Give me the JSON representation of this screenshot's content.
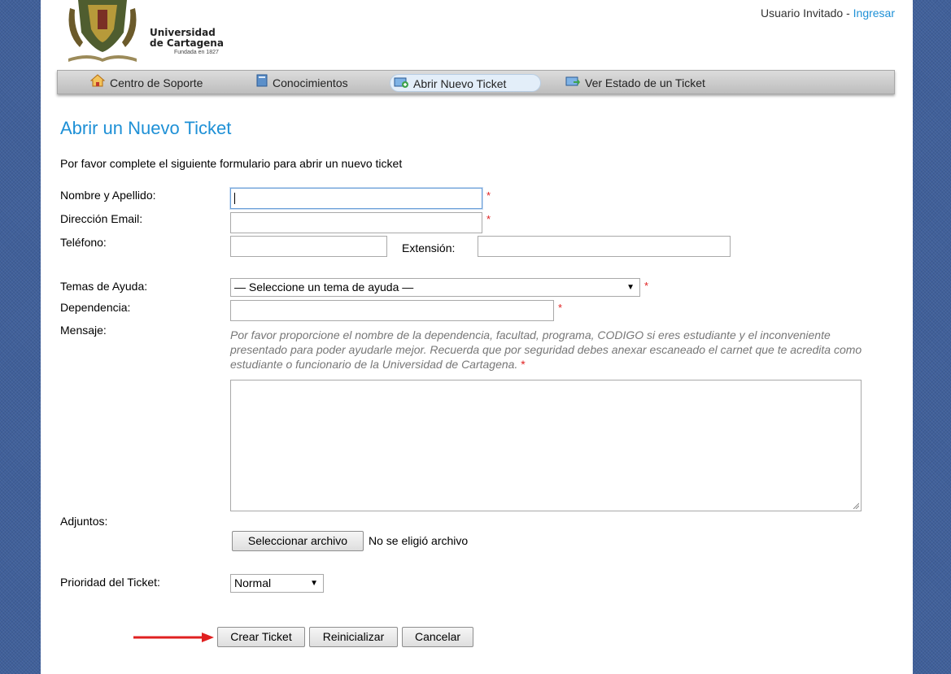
{
  "header": {
    "logo_line1": "Universidad",
    "logo_line2": "de Cartagena",
    "logo_line3": "Fundada en 1827",
    "user_status": "Usuario Invitado",
    "separator": " - ",
    "login_link": "Ingresar"
  },
  "nav": {
    "items": [
      {
        "label": "Centro de Soporte",
        "icon": "home-icon"
      },
      {
        "label": "Conocimientos",
        "icon": "book-icon"
      },
      {
        "label": "Abrir Nuevo Ticket",
        "icon": "new-ticket-icon",
        "active": true
      },
      {
        "label": "Ver Estado de un Ticket",
        "icon": "ticket-status-icon"
      }
    ]
  },
  "page": {
    "title": "Abrir un Nuevo Ticket",
    "intro": "Por favor complete el siguiente formulario para abrir un nuevo ticket"
  },
  "form": {
    "name_label": "Nombre y Apellido:",
    "email_label": "Dirección Email:",
    "phone_label": "Teléfono:",
    "extension_label": "Extensión:",
    "topic_label": "Temas de Ayuda:",
    "topic_value": "— Seleccione un tema de ayuda —",
    "department_label": "Dependencia:",
    "message_label": "Mensaje:",
    "message_help": "Por favor proporcione el nombre de la dependencia, facultad, programa, CODIGO si eres estudiante y el inconveniente presentado para poder ayudarle mejor. Recuerda que por seguridad debes anexar escaneado el carnet que te acredita como estudiante o funcionario de la Universidad de Cartagena.",
    "required_mark": "*",
    "attachments_label": "Adjuntos:",
    "file_button": "Seleccionar archivo",
    "file_status": "No se eligió archivo",
    "priority_label": "Prioridad del Ticket:",
    "priority_value": "Normal"
  },
  "actions": {
    "create": "Crear Ticket",
    "reset": "Reinicializar",
    "cancel": "Cancelar"
  },
  "colors": {
    "accent": "#1e90d6",
    "required": "#e02020",
    "arrow": "#e02020",
    "background": "#40609a"
  }
}
